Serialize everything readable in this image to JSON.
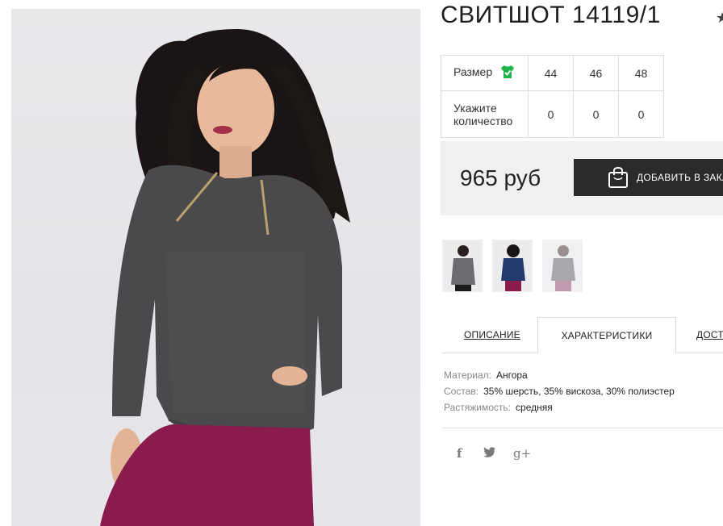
{
  "product": {
    "title": "СВИТШОТ 14119/1",
    "favorite_icon": "star-icon"
  },
  "sizes": {
    "size_label": "Размер",
    "size_icon": "tshirt-icon",
    "size_icon_color": "#1fb44a",
    "sizes": [
      "44",
      "46",
      "48"
    ],
    "qty_label_line1": "Укажите",
    "qty_label_line2": "количество",
    "quantities": [
      "0",
      "0",
      "0"
    ]
  },
  "purchase": {
    "price": "965 руб",
    "add_to_cart_label": "ДОБАВИТЬ В ЗАКАЗ",
    "cart_icon": "shopping-bag-icon"
  },
  "thumbnails": [
    {
      "alt": "grey-sweatshirt-thumbnail"
    },
    {
      "alt": "navy-sweatshirt-thumbnail"
    },
    {
      "alt": "light-grey-sweatshirt-thumbnail"
    }
  ],
  "tabs": [
    {
      "label": "ОПИСАНИЕ",
      "active": false
    },
    {
      "label": "ХАРАКТЕРИСТИКИ",
      "active": true
    },
    {
      "label": "ДОСТАВКА",
      "active": false
    }
  ],
  "specs": [
    {
      "key": "Материал:",
      "value": "Ангора"
    },
    {
      "key": "Состав:",
      "value": "35% шерсть, 35% вискоза, 30% полиэстер"
    },
    {
      "key": "Растяжимость:",
      "value": "средняя"
    }
  ],
  "social": [
    {
      "icon": "facebook-icon",
      "glyph": "f"
    },
    {
      "icon": "twitter-icon",
      "glyph": "🐦"
    },
    {
      "icon": "google-plus-icon",
      "glyph": "g+"
    }
  ]
}
